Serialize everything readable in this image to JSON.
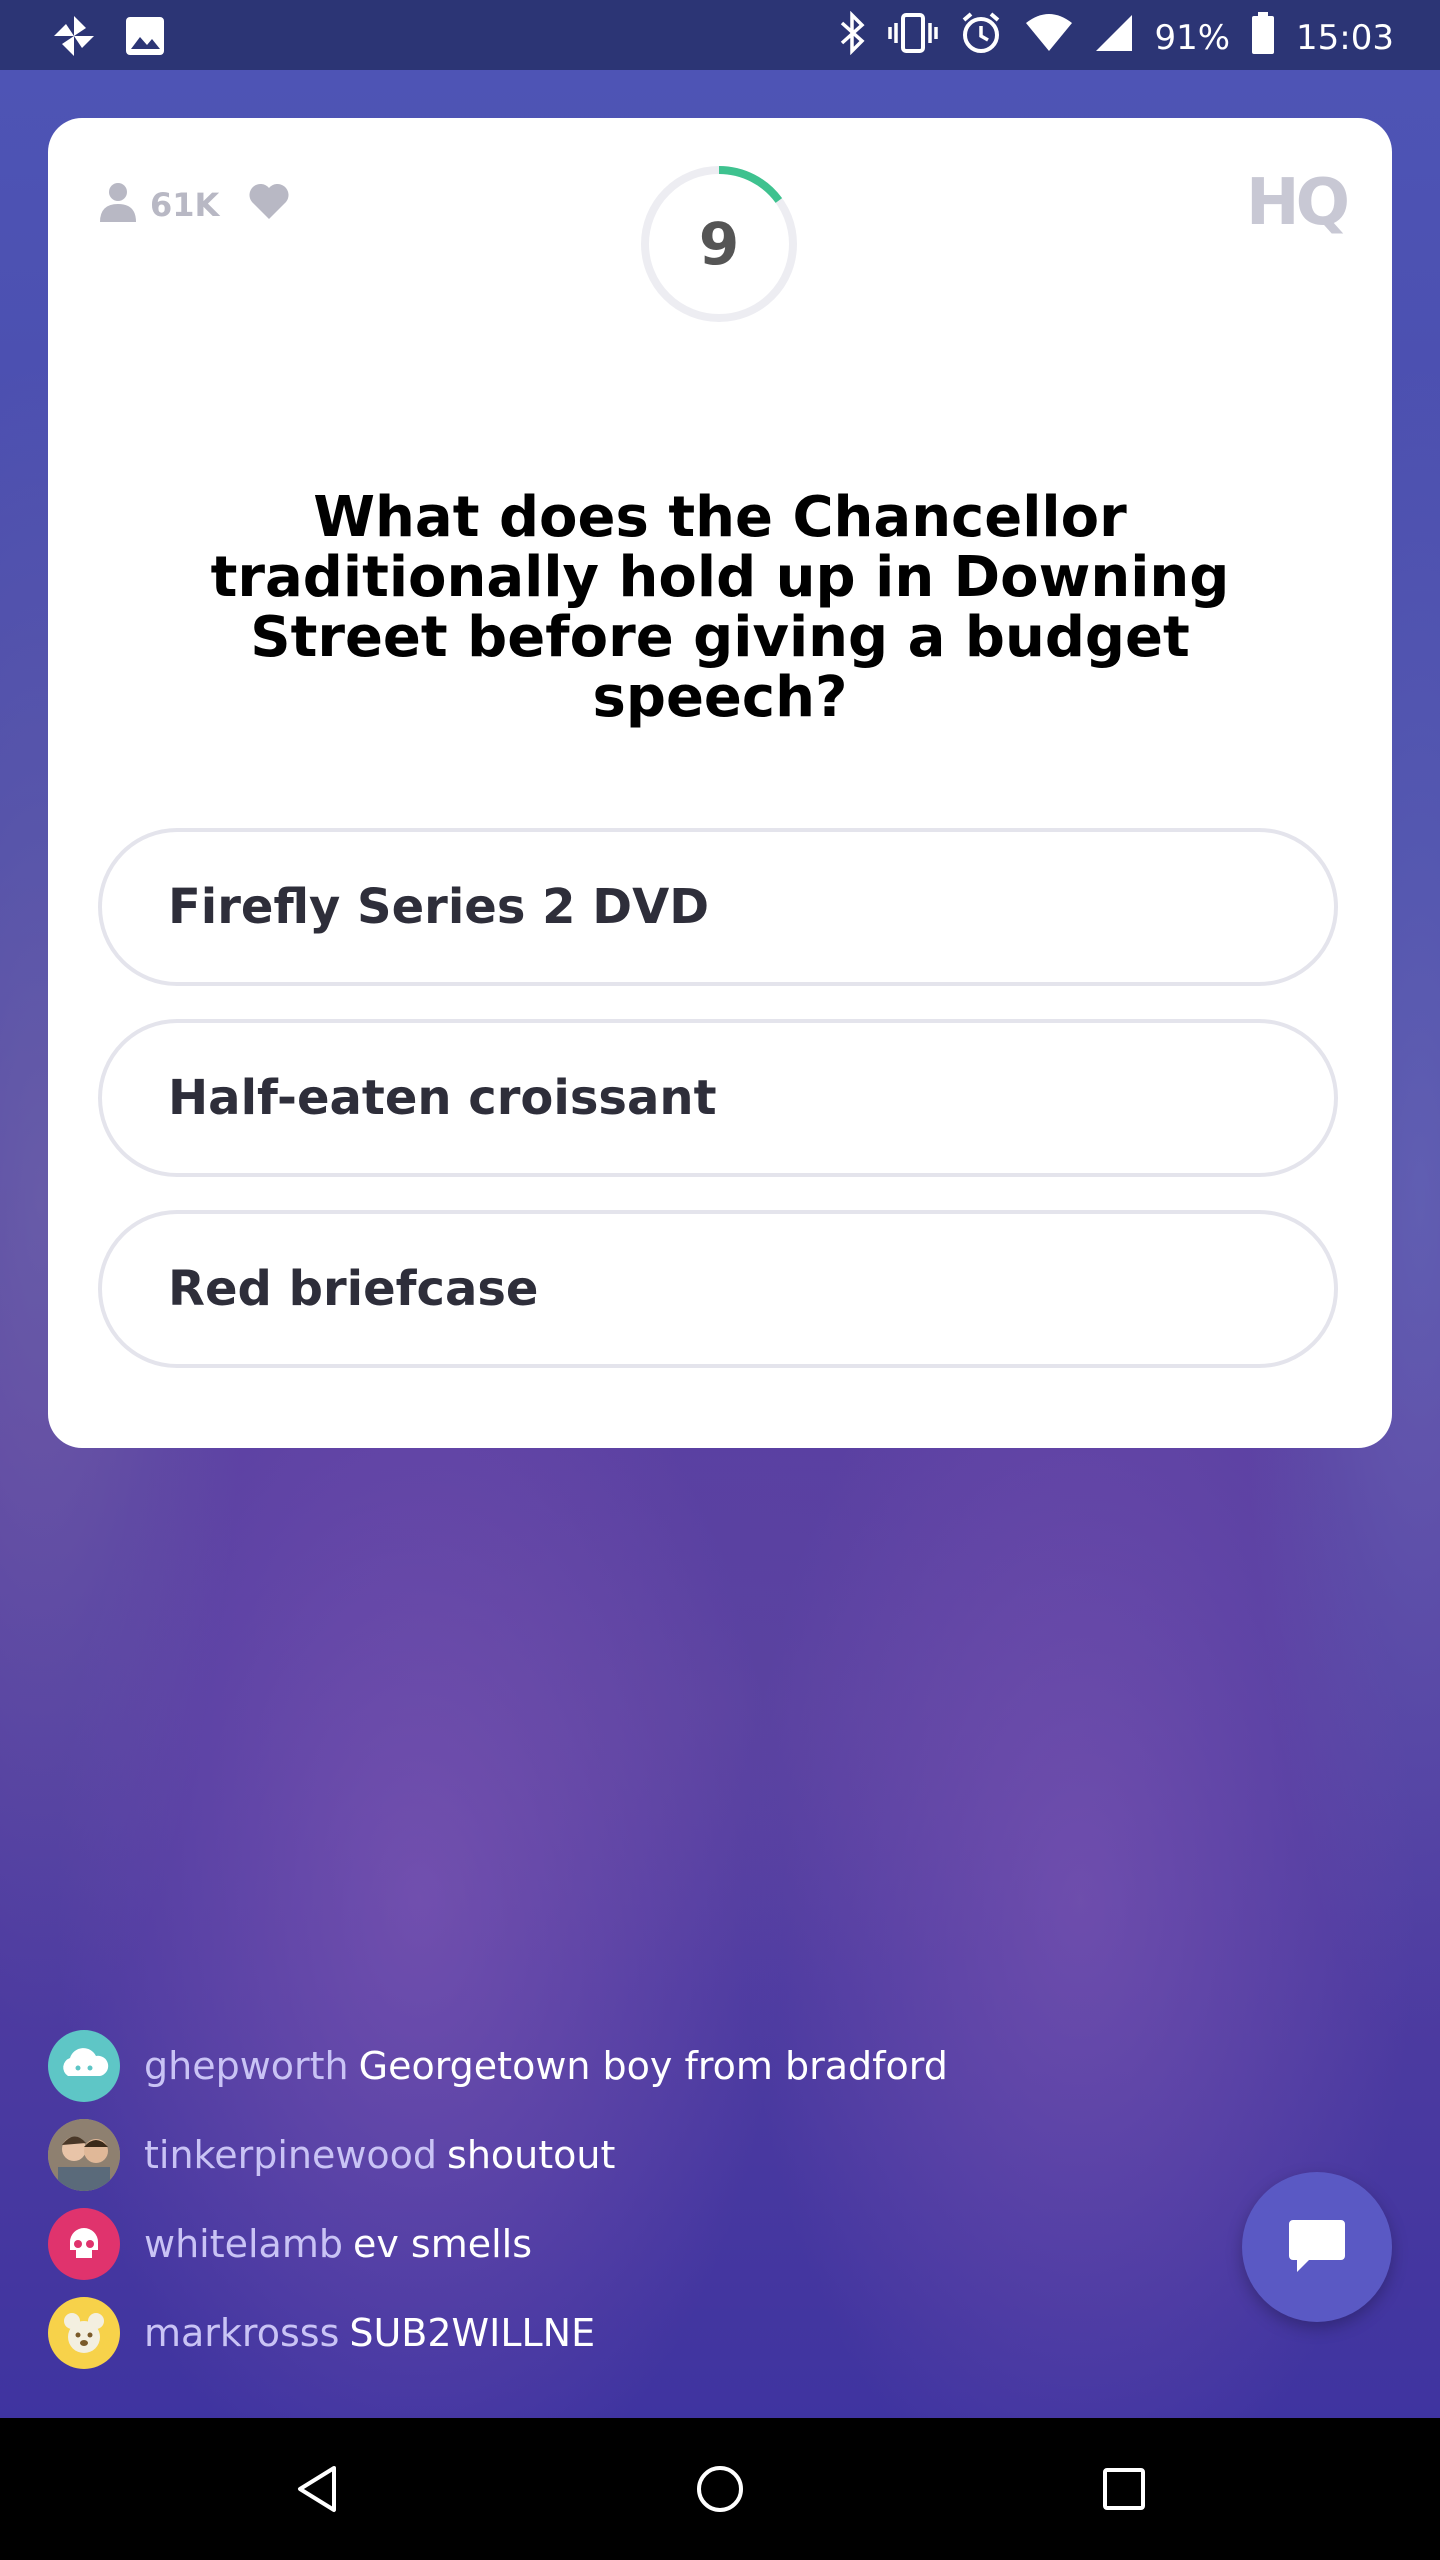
{
  "status_bar": {
    "battery_percent": "91%",
    "time": "15:03",
    "icons": [
      "pinwheel-icon",
      "gallery-icon",
      "bluetooth-icon",
      "vibrate-icon",
      "alarm-icon",
      "wifi-icon",
      "signal-icon",
      "battery-icon"
    ]
  },
  "card": {
    "viewers": "61K",
    "timer": "9",
    "timer_progress": 0.15,
    "logo": "HQ",
    "question": "What does the Chancellor traditionally hold up in Downing Street before giving a budget speech?",
    "answers": [
      {
        "label": "Firefly Series 2 DVD"
      },
      {
        "label": "Half-eaten croissant"
      },
      {
        "label": "Red briefcase"
      }
    ]
  },
  "chat": [
    {
      "user": "ghepworth",
      "message": "Georgetown boy from bradford",
      "avatar_color": "#5ec6c6"
    },
    {
      "user": "tinkerpinewood",
      "message": "shoutout",
      "avatar_color": "#a89a8a"
    },
    {
      "user": "whitelamb",
      "message": "ev smells",
      "avatar_color": "#e0336d"
    },
    {
      "user": "markrosss",
      "message": "SUB2WILLNE",
      "avatar_color": "#f7d24a"
    }
  ],
  "colors": {
    "accent_timer": "#3ec28f",
    "chat_button": "#5a59c4"
  }
}
